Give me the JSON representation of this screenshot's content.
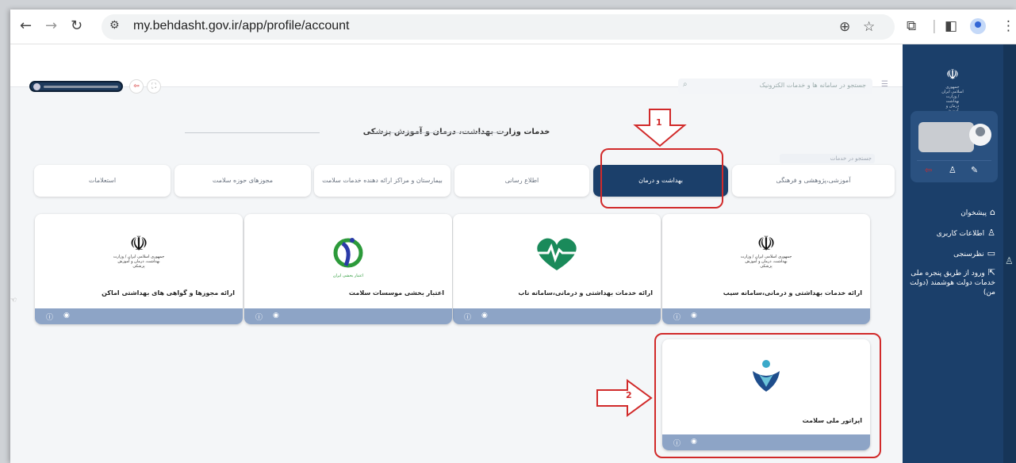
{
  "browser": {
    "url": "my.behdasht.gov.ir/app/profile/account",
    "icons": [
      "back-icon",
      "forward-icon",
      "reload-icon",
      "tune-icon",
      "zoom-icon",
      "star-icon",
      "extensions-icon",
      "sidepanel-icon",
      "profile-icon",
      "more-icon"
    ]
  },
  "header": {
    "search_placeholder": "جستجو در سامانه ها و خدمات الکترونیک"
  },
  "section": {
    "title": "خدمات وزارت بهداشت، درمان و آموزش پزشکی",
    "search_hint": "جستجو در خدمات"
  },
  "tabs": [
    {
      "label": "آموزشی،پژوهشی و فرهنگی"
    },
    {
      "label": "بهداشت و درمان",
      "active": true
    },
    {
      "label": "اطلاع رسانی"
    },
    {
      "label": "بیمارستان و مراکز ارائه دهنده خدمات سلامت"
    },
    {
      "label": "مجوزهای حوزه سلامت"
    },
    {
      "label": "استعلامات"
    }
  ],
  "cards": [
    {
      "title": "ارائه خدمات بهداشتی و درمانی،سامانه سیب",
      "logo": "iran-emblem-icon",
      "logo_text": "جمهوری اسلامی ایران / وزارت بهداشت، درمان و آموزش پزشکی"
    },
    {
      "title": "ارائه خدمات بهداشتی و درمانی،سامانه ناب",
      "logo": "heart-pulse-icon"
    },
    {
      "title": "اعتبار بخشی موسسات سلامت",
      "logo": "accreditation-icon",
      "logo_text": "اعتبار بخشی ایران"
    },
    {
      "title": "ارائه مجوزها و گواهی های بهداشتی اماکن",
      "logo": "iran-emblem-icon",
      "logo_text": "جمهوری اسلامی ایران / وزارت بهداشت، درمان و آموزش پزشکی"
    },
    {
      "title": "اپراتور ملی سلامت",
      "logo": "national-health-operator-icon"
    }
  ],
  "sidebar": {
    "logo_text": "جمهوری اسلامی ایران / وزارت بهداشت درمان و آموزش پزشکی",
    "items": [
      {
        "label": "پیشخوان",
        "icon": "home-icon"
      },
      {
        "label": "اطلاعات کاربری",
        "icon": "user-icon"
      },
      {
        "label": "نظرسنجی",
        "icon": "comment-icon"
      },
      {
        "label": "ورود از طریق پنجره ملی خدمات دولت هوشمند (دولت من)",
        "icon": "external-link-icon"
      }
    ]
  },
  "annotations": {
    "step1": "1",
    "step2": "2",
    "color": "#d12a2a"
  },
  "colors": {
    "sidebar": "#1b3f6a",
    "active_tab": "#1b3f6a",
    "card_footer": "#8da4c6"
  }
}
